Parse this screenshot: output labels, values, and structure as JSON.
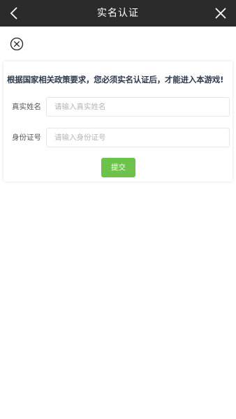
{
  "header": {
    "title": "实名认证",
    "back_icon": "chevron-left-icon",
    "close_icon": "close-icon",
    "background": "#2b2b2b"
  },
  "dismiss_icon": "circle-close-icon",
  "form": {
    "notice": "根据国家相关政策要求，您必须实名认证后，才能进入本游戏!",
    "fields": [
      {
        "label": "真实姓名",
        "value": "",
        "placeholder": "请输入真实姓名"
      },
      {
        "label": "身份证号",
        "value": "",
        "placeholder": "请输入身份证号"
      }
    ],
    "submit_label": "提交",
    "submit_color": "#6cc24a"
  }
}
